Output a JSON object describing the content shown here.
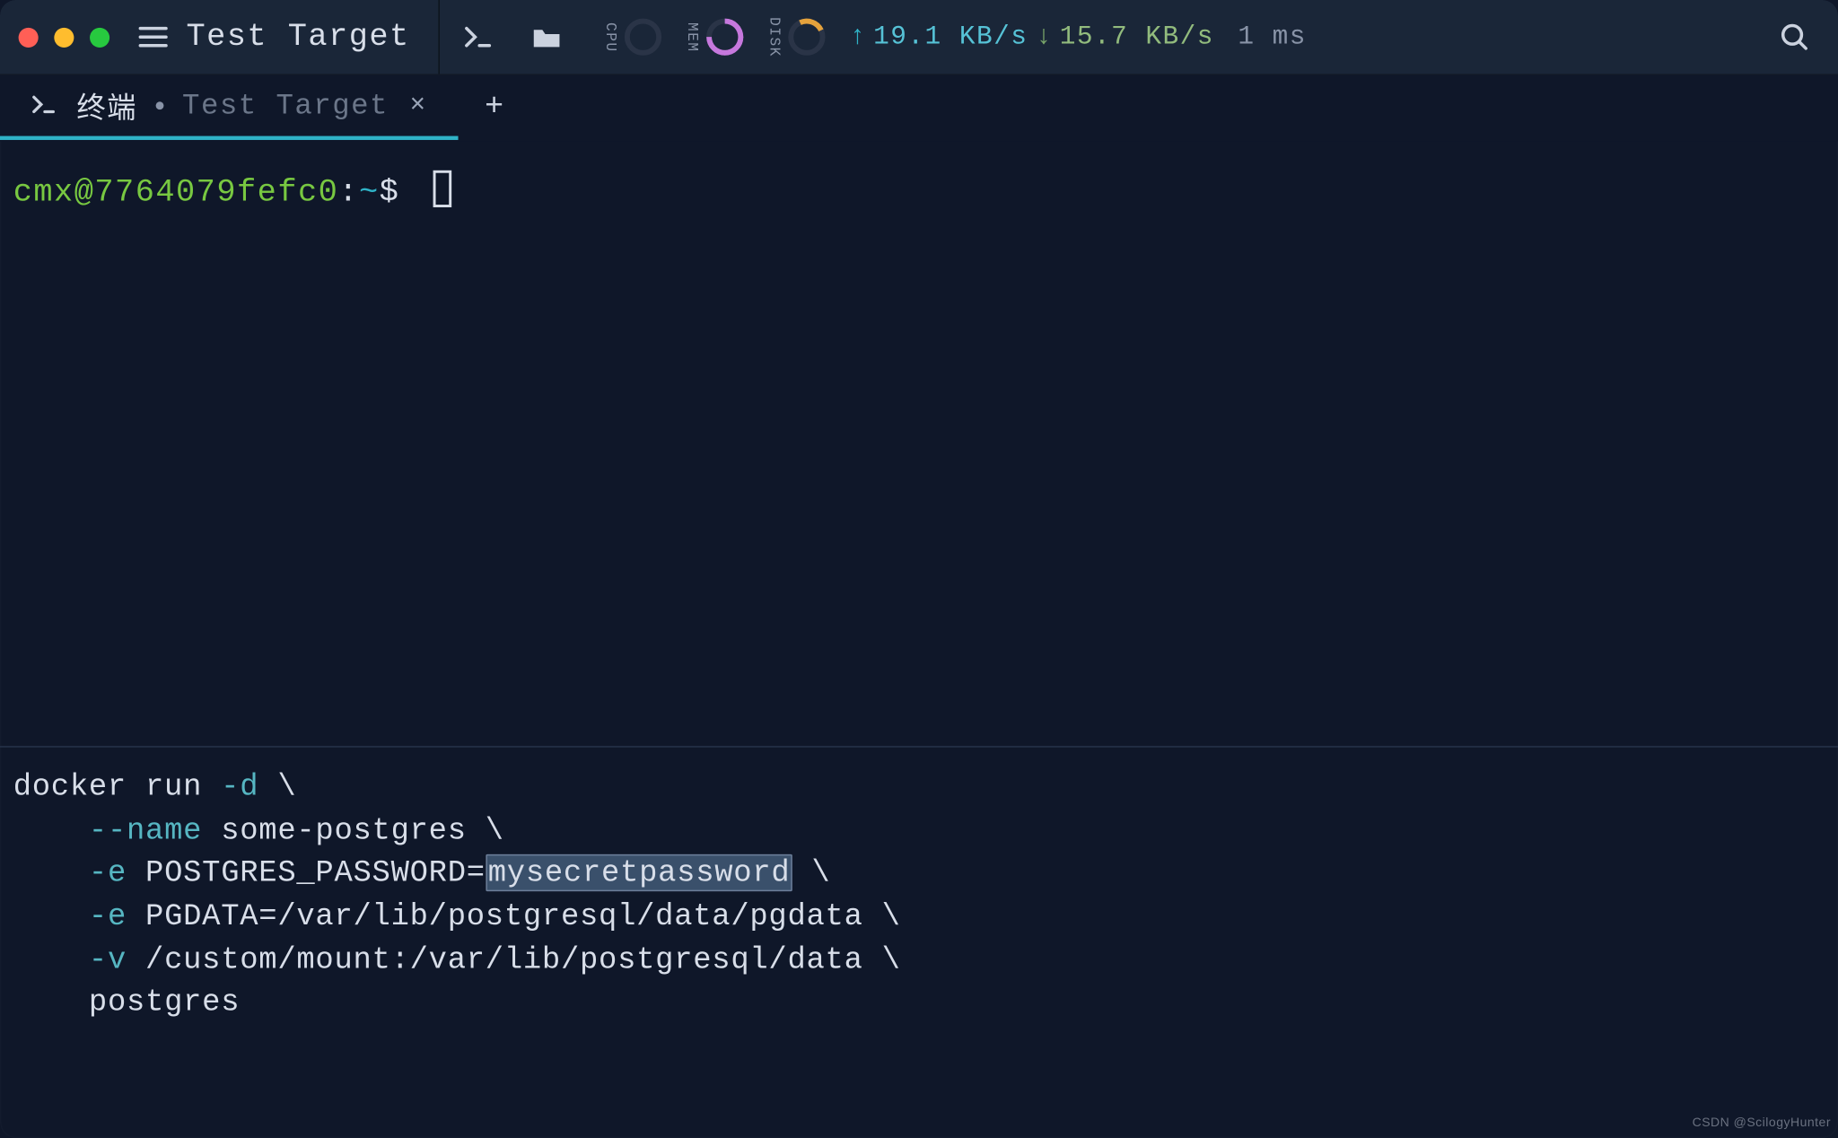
{
  "titlebar": {
    "window_title": "Test Target",
    "stats": {
      "cpu_label": "CPU",
      "mem_label": "MEM",
      "disk_label": "DISK",
      "net_up_arrow": "↑",
      "net_up_value": "19.1 KB/s",
      "net_down_arrow": "↓",
      "net_down_value": "15.7 KB/s",
      "latency": "1 ms"
    }
  },
  "tabs": {
    "active": {
      "label": "终端",
      "subtitle": "Test Target",
      "close_glyph": "×"
    },
    "new_tab_glyph": "+"
  },
  "prompt": {
    "user": "cmx",
    "at": "@",
    "host": "7764079fefc0",
    "colon": ":",
    "path": "~",
    "symbol": "$"
  },
  "code": {
    "l1_cmd": "docker run ",
    "l1_flag": "-d",
    "l1_tail": " \\",
    "l2_flag": "--name",
    "l2_rest": " some-postgres \\",
    "l3_flag": "-e",
    "l3_key": " POSTGRES_PASSWORD=",
    "l3_val": "mysecretpassword",
    "l3_tail": " \\",
    "l4_flag": "-e",
    "l4_rest": " PGDATA=/var/lib/postgresql/data/pgdata \\",
    "l5_flag": "-v",
    "l5_rest": " /custom/mount:/var/lib/postgresql/data \\",
    "l6": "postgres"
  },
  "watermark": "CSDN @ScilogyHunter"
}
